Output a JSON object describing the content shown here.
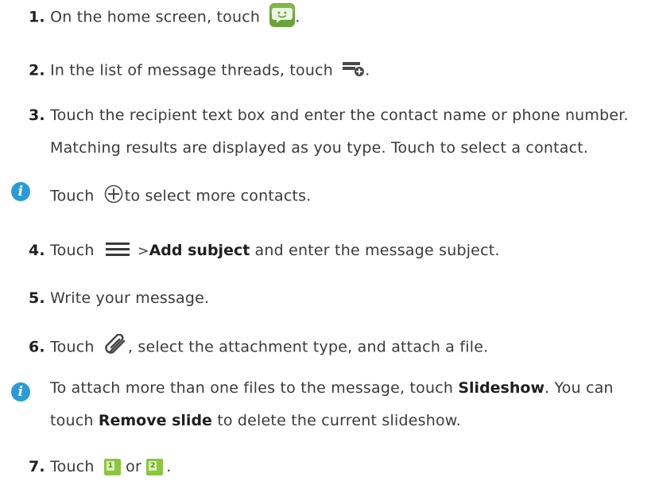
{
  "steps": [
    {
      "num": "1.",
      "text_a": "On the home screen, touch",
      "text_b": "."
    },
    {
      "num": "2.",
      "text_a": "In the list of message threads, touch",
      "text_b": "."
    },
    {
      "num": "3.",
      "text_a": "Touch the recipient text box and enter the contact name or phone number.",
      "text_b": "Matching results are displayed as you type. Touch to select a contact."
    },
    {
      "num": "4.",
      "text_a": "Touch",
      "text_gt": ">",
      "bold": "Add subject",
      "text_b": "and enter the message subject."
    },
    {
      "num": "5.",
      "text_a": "Write your message."
    },
    {
      "num": "6.",
      "text_a": "Touch",
      "text_b": ", select the attachment type, and attach a file."
    },
    {
      "num": "7.",
      "text_a": "Touch",
      "text_or": "or",
      "text_b": "."
    }
  ],
  "notes": [
    {
      "text_a": "Touch",
      "text_b": "to select more contacts."
    },
    {
      "text_a": "To attach more than one files to the message, touch",
      "bold_a": "Slideshow",
      "text_b": ". You can",
      "text_c": "touch",
      "bold_b": "Remove slide",
      "text_d": "to delete the current slideshow."
    }
  ],
  "sim1_label": "1",
  "sim2_label": "2",
  "note_icon_glyph": "i",
  "colors": {
    "info": "#2a9bd6",
    "sim": "#8cc63f",
    "messaging_app": "#6aa33a"
  },
  "icons": [
    "messaging-app-icon",
    "new-message-icon",
    "add-contact-icon",
    "menu-icon",
    "attachment-icon",
    "sim1-icon",
    "sim2-icon",
    "info-icon"
  ]
}
